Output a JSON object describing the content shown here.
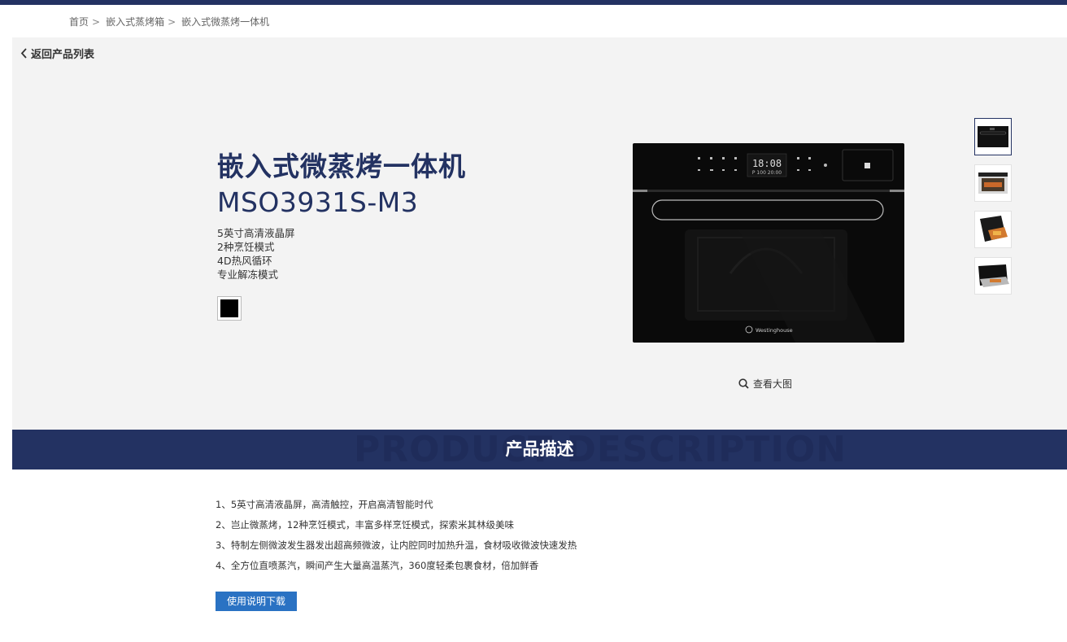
{
  "breadcrumb": {
    "items": [
      "首页",
      "嵌入式蒸烤箱",
      "嵌入式微蒸烤一体机"
    ],
    "separator": ">"
  },
  "back_link": {
    "label": "返回产品列表"
  },
  "product": {
    "title": "嵌入式微蒸烤一体机",
    "model": "MSO3931S-M3",
    "features": [
      "5英寸高清液晶屏",
      "2种烹饪模式",
      "4D热风循环",
      "专业解冻模式"
    ],
    "color_swatch": "#000000",
    "display_time": "18:08",
    "display_sub": "P 100  20:00",
    "brand_logo": "Westinghouse"
  },
  "gallery": {
    "zoom_label": "查看大图",
    "thumbnail_icons": [
      "oven-front-thumb",
      "oven-open-thumb",
      "oven-angle-thumb",
      "oven-drawer-thumb"
    ]
  },
  "description": {
    "heading": "产品描述",
    "background_text": "PRODUCT DESCRIPTION",
    "items": [
      "1、5英寸高清液晶屏，高清触控，开启高清智能时代",
      "2、岂止微蒸烤，12种烹饪模式，丰富多样烹饪模式，探索米其林级美味",
      "3、特制左侧微波发生器发出超高频微波，让内腔同时加热升温，食材吸收微波快速发热",
      "4、全方位直喷蒸汽，瞬间产生大量高温蒸汽，360度轻柔包裹食材，倍加鲜香"
    ],
    "download_label": "使用说明下载"
  },
  "colors": {
    "brand_navy": "#233262",
    "button_blue": "#2a72c3",
    "hero_bg": "#f3f3f3"
  }
}
